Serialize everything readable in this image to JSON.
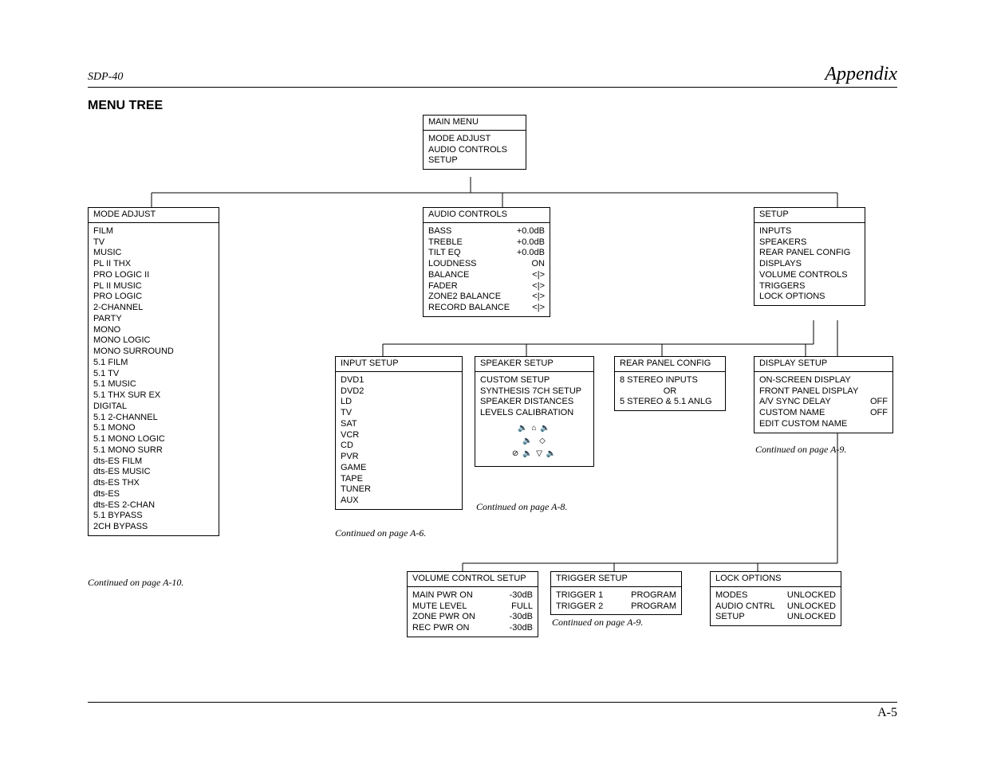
{
  "header": {
    "left": "SDP-40",
    "right": "Appendix"
  },
  "title": "MENU TREE",
  "footer": "A-5",
  "mainMenu": {
    "title": "MAIN MENU",
    "items": [
      "MODE ADJUST",
      "AUDIO CONTROLS",
      "SETUP"
    ]
  },
  "modeAdjust": {
    "title": "MODE ADJUST",
    "items": [
      "FILM",
      "TV",
      "MUSIC",
      "PL II THX",
      "PRO LOGIC II",
      "PL II MUSIC",
      "PRO LOGIC",
      "2-CHANNEL",
      "PARTY",
      "MONO",
      "MONO LOGIC",
      "MONO SURROUND",
      "5.1 FILM",
      "5.1 TV",
      "5.1 MUSIC",
      "5.1 THX SUR EX",
      "DIGITAL",
      "5.1 2-CHANNEL",
      "5.1 MONO",
      "5.1 MONO LOGIC",
      "5.1 MONO SURR",
      "dts-ES FILM",
      "dts-ES MUSIC",
      "dts-ES THX",
      "dts-ES",
      "dts-ES 2-CHAN",
      "5.1 BYPASS",
      "2CH BYPASS"
    ],
    "cont": "Continued on page A-10."
  },
  "audioControls": {
    "title": "AUDIO CONTROLS",
    "rows": [
      {
        "l": "BASS",
        "r": "+0.0dB"
      },
      {
        "l": "TREBLE",
        "r": "+0.0dB"
      },
      {
        "l": "TILT EQ",
        "r": "+0.0dB"
      },
      {
        "l": "LOUDNESS",
        "r": "ON"
      },
      {
        "l": "BALANCE",
        "r": "<|>"
      },
      {
        "l": "FADER",
        "r": "<|>"
      },
      {
        "l": "ZONE2 BALANCE",
        "r": "<|>"
      },
      {
        "l": "RECORD BALANCE",
        "r": "<|>"
      }
    ]
  },
  "setup": {
    "title": "SETUP",
    "items": [
      "INPUTS",
      "SPEAKERS",
      "REAR PANEL CONFIG",
      "DISPLAYS",
      "VOLUME CONTROLS",
      "TRIGGERS",
      "LOCK OPTIONS"
    ]
  },
  "inputSetup": {
    "title": "INPUT SETUP",
    "items": [
      "DVD1",
      "DVD2",
      "LD",
      "TV",
      "SAT",
      "VCR",
      "CD",
      "PVR",
      "GAME",
      "TAPE",
      "TUNER",
      "AUX"
    ],
    "cont": "Continued on page A-6."
  },
  "speakerSetup": {
    "title": "SPEAKER SETUP",
    "items": [
      "CUSTOM SETUP",
      "SYNTHESIS 7CH SETUP",
      "SPEAKER DISTANCES",
      "LEVELS CALIBRATION"
    ],
    "cont": "Continued on page A-8."
  },
  "rearPanel": {
    "title": "REAR PANEL CONFIG",
    "items": [
      "8 STEREO INPUTS",
      "OR",
      "5 STEREO & 5.1 ANLG"
    ]
  },
  "displaySetup": {
    "title": "DISPLAY SETUP",
    "rows": [
      {
        "l": "ON-SCREEN DISPLAY",
        "r": ""
      },
      {
        "l": "FRONT PANEL DISPLAY",
        "r": ""
      },
      {
        "l": "A/V SYNC DELAY",
        "r": "OFF"
      },
      {
        "l": "CUSTOM NAME",
        "r": "OFF"
      },
      {
        "l": "EDIT CUSTOM NAME",
        "r": ""
      }
    ],
    "cont": "Continued on page A-9."
  },
  "volumeControl": {
    "title": "VOLUME CONTROL SETUP",
    "rows": [
      {
        "l": "MAIN PWR ON",
        "r": "-30dB"
      },
      {
        "l": "MUTE LEVEL",
        "r": "FULL"
      },
      {
        "l": "ZONE PWR ON",
        "r": "-30dB"
      },
      {
        "l": "REC PWR ON",
        "r": "-30dB"
      }
    ]
  },
  "triggerSetup": {
    "title": "TRIGGER SETUP",
    "rows": [
      {
        "l": "TRIGGER 1",
        "r": "PROGRAM"
      },
      {
        "l": "TRIGGER 2",
        "r": "PROGRAM"
      }
    ],
    "cont": "Continued on page A-9."
  },
  "lockOptions": {
    "title": "LOCK OPTIONS",
    "rows": [
      {
        "l": "MODES",
        "r": "UNLOCKED"
      },
      {
        "l": "AUDIO CNTRL",
        "r": "UNLOCKED"
      },
      {
        "l": "SETUP",
        "r": "UNLOCKED"
      }
    ]
  }
}
